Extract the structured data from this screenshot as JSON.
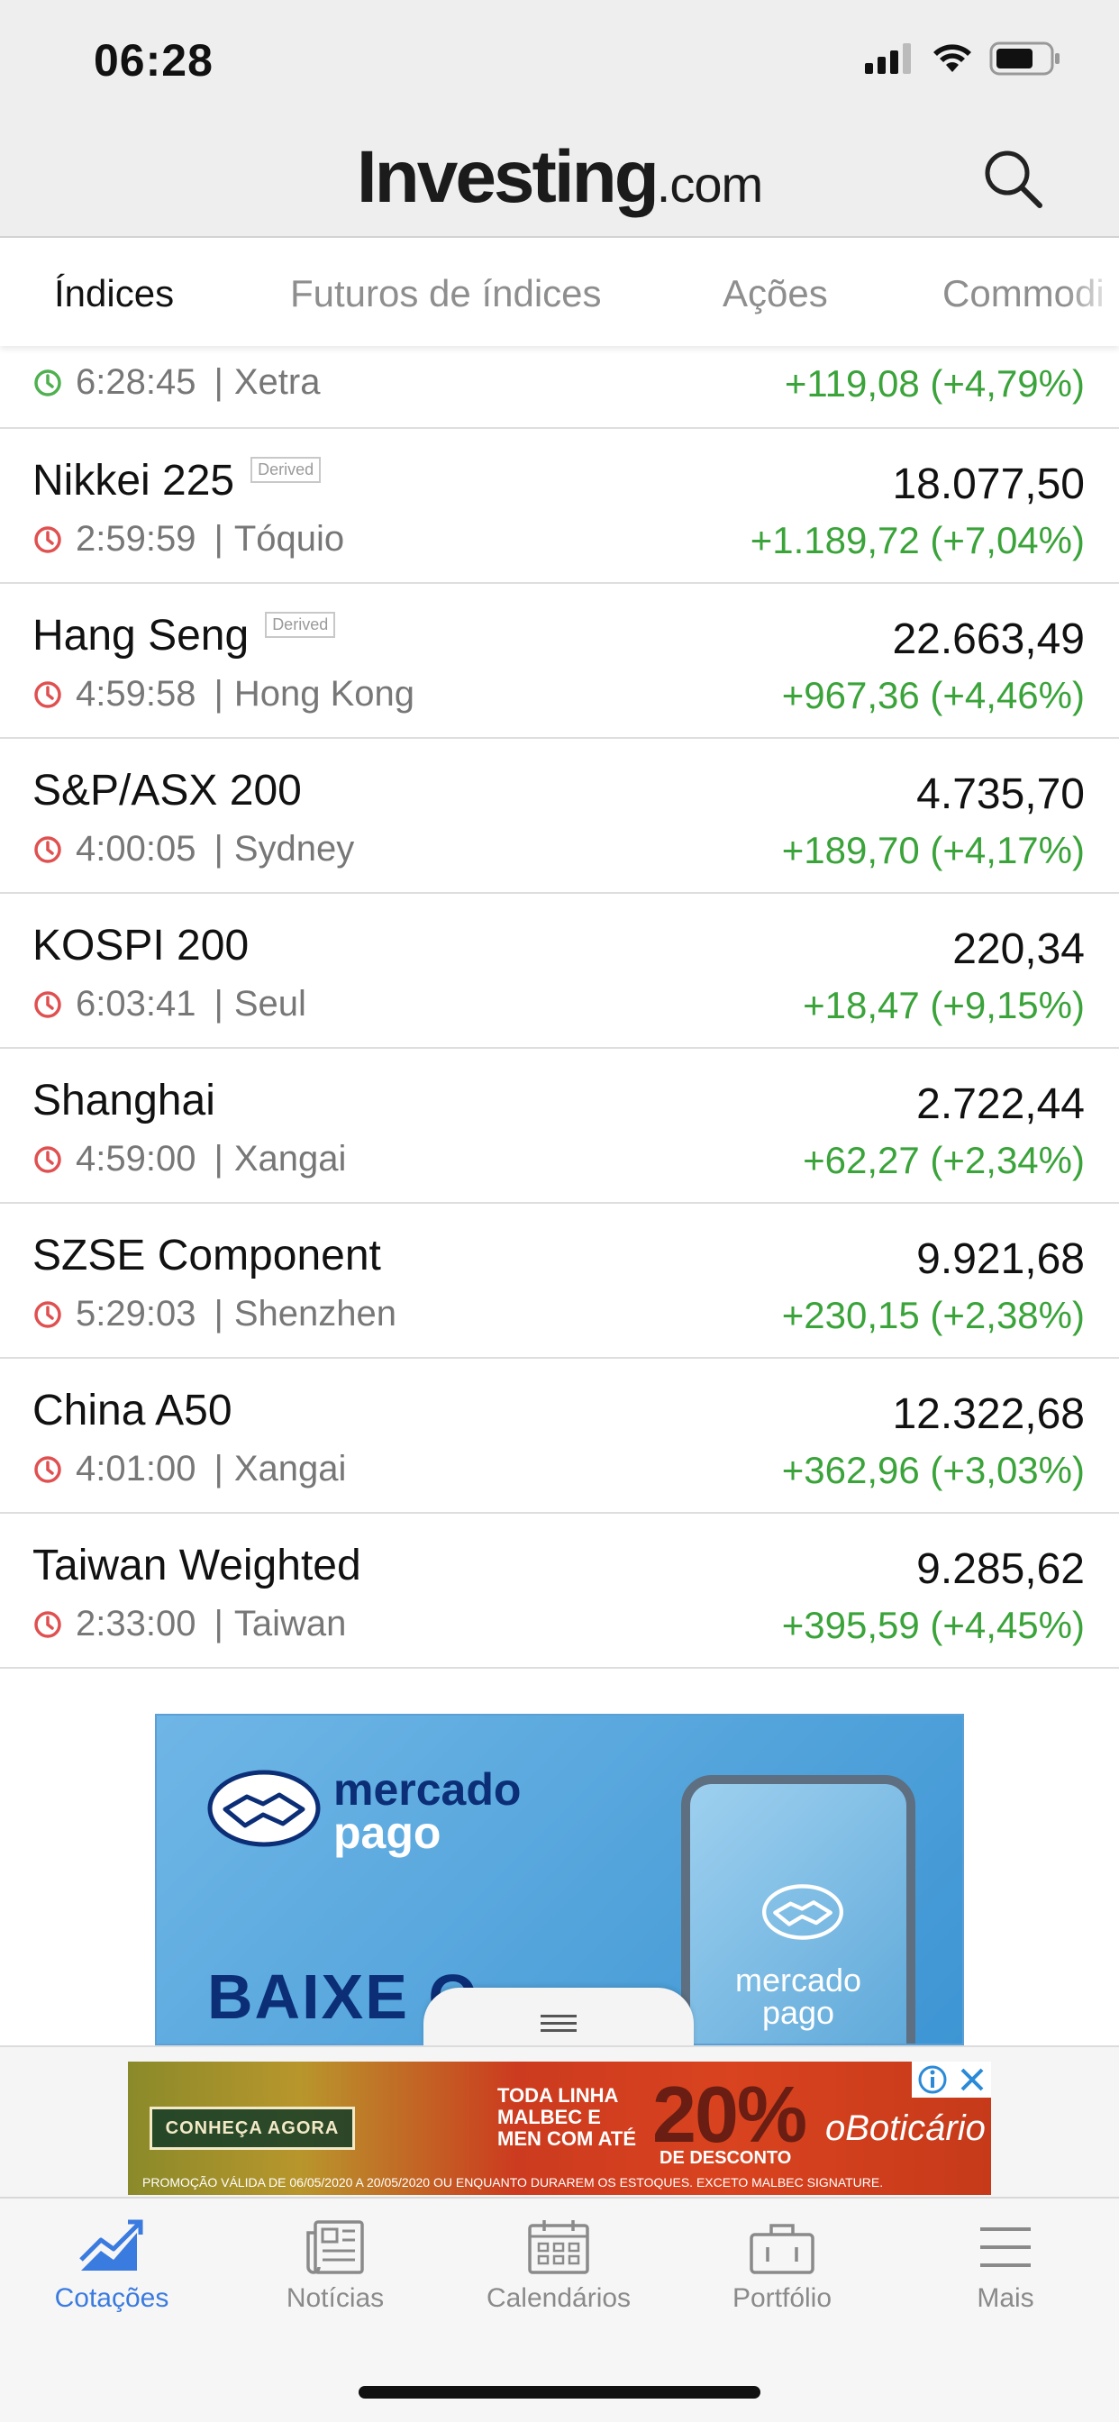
{
  "status_bar": {
    "time": "06:28"
  },
  "header": {
    "brand": "Investing",
    "brand_suffix": ".com"
  },
  "tabs": [
    {
      "label": "Índices",
      "active": true
    },
    {
      "label": "Futuros de índices",
      "active": false
    },
    {
      "label": "Ações",
      "active": false
    },
    {
      "label": "Commodi",
      "active": false
    }
  ],
  "rows": [
    {
      "name": "",
      "derived": false,
      "time": "6:28:45",
      "exchange": "Xetra",
      "price": "",
      "change": "+119,08 (+4,79%)",
      "clock_color": "#4fb04f"
    },
    {
      "name": "Nikkei 225",
      "derived": true,
      "time": "2:59:59",
      "exchange": "Tóquio",
      "price": "18.077,50",
      "change": "+1.189,72 (+7,04%)",
      "clock_color": "#e05050"
    },
    {
      "name": "Hang Seng",
      "derived": true,
      "time": "4:59:58",
      "exchange": "Hong Kong",
      "price": "22.663,49",
      "change": "+967,36 (+4,46%)",
      "clock_color": "#e05050"
    },
    {
      "name": "S&P/ASX 200",
      "derived": false,
      "time": "4:00:05",
      "exchange": "Sydney",
      "price": "4.735,70",
      "change": "+189,70 (+4,17%)",
      "clock_color": "#e05050"
    },
    {
      "name": "KOSPI 200",
      "derived": false,
      "time": "6:03:41",
      "exchange": "Seul",
      "price": "220,34",
      "change": "+18,47 (+9,15%)",
      "clock_color": "#e05050"
    },
    {
      "name": "Shanghai",
      "derived": false,
      "time": "4:59:00",
      "exchange": "Xangai",
      "price": "2.722,44",
      "change": "+62,27 (+2,34%)",
      "clock_color": "#e05050"
    },
    {
      "name": "SZSE Component",
      "derived": false,
      "time": "5:29:03",
      "exchange": "Shenzhen",
      "price": "9.921,68",
      "change": "+230,15 (+2,38%)",
      "clock_color": "#e05050"
    },
    {
      "name": "China A50",
      "derived": false,
      "time": "4:01:00",
      "exchange": "Xangai",
      "price": "12.322,68",
      "change": "+362,96 (+3,03%)",
      "clock_color": "#e05050"
    },
    {
      "name": "Taiwan Weighted",
      "derived": false,
      "time": "2:33:00",
      "exchange": "Taiwan",
      "price": "9.285,62",
      "change": "+395,59 (+4,45%)",
      "clock_color": "#e05050"
    }
  ],
  "derived_label": "Derived",
  "separator": "|",
  "ad": {
    "brand_top": "mercado",
    "brand_bottom": "pago",
    "headline": "BAIXE O",
    "phone_brand_top": "mercado",
    "phone_brand_bottom": "pago"
  },
  "bottom_ad": {
    "cta": "CONHEÇA AGORA",
    "line1": "TODA LINHA MALBEC E MEN COM ATÉ",
    "percent": "20%",
    "desc": "DE DESCONTO",
    "brand": "oBoticário",
    "fine_print": "PROMOÇÃO VÁLIDA DE 06/05/2020 A 20/05/2020 OU ENQUANTO DURAREM OS ESTOQUES. EXCETO MALBEC SIGNATURE."
  },
  "bottom_nav": [
    {
      "label": "Cotações",
      "icon": "chart-trend-icon",
      "active": true
    },
    {
      "label": "Notícias",
      "icon": "newspaper-icon",
      "active": false
    },
    {
      "label": "Calendários",
      "icon": "calendar-icon",
      "active": false
    },
    {
      "label": "Portfólio",
      "icon": "briefcase-icon",
      "active": false
    },
    {
      "label": "Mais",
      "icon": "menu-icon",
      "active": false
    }
  ],
  "colors": {
    "positive": "#3aa33a",
    "accent": "#3a7be0",
    "clock_open": "#4fb04f",
    "clock_closed": "#e05050"
  }
}
